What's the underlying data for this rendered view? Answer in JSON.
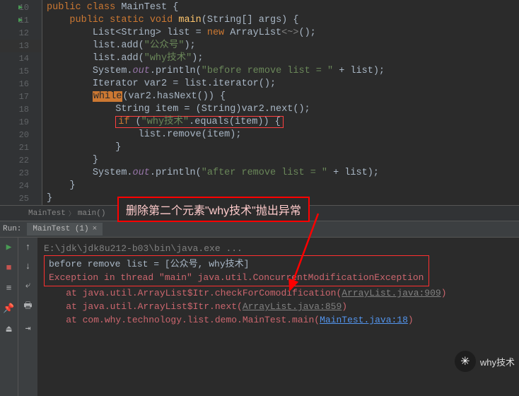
{
  "gutter": {
    "start": 10,
    "end": 25,
    "runMarkers": [
      10,
      11
    ]
  },
  "code": {
    "l10": {
      "kw1": "public class ",
      "cls": "MainTest",
      "end": " {"
    },
    "l11": {
      "kw1": "public static void ",
      "fn": "main",
      "args": "(String[] args) {"
    },
    "l12": {
      "t1": "List<String> list = ",
      "kw": "new ",
      "t2": "ArrayList",
      "gr": "<~>",
      "t3": "();"
    },
    "l13": {
      "t1": "list.add(",
      "s": "\"公众号\"",
      "t2": ");"
    },
    "l14": {
      "t1": "list.add(",
      "s": "\"why技术\"",
      "t2": ");"
    },
    "l15": {
      "t1": "System.",
      "f": "out",
      "t2": ".println(",
      "s": "\"before remove list = \"",
      "t3": " + list);"
    },
    "l16": {
      "t1": "Iterator var2 = list.iterator();"
    },
    "l17": {
      "kw": "while",
      "t1": "(var2.hasNext()) {"
    },
    "l18": {
      "t1": "String item = (String)var2.next();"
    },
    "l19": {
      "kw": "if ",
      "op": "(",
      "s": "\"why技术\"",
      "t1": ".equals(item)) {"
    },
    "l20": {
      "t1": "list.remove(item);"
    },
    "l21": {
      "t1": "}"
    },
    "l22": {
      "t1": "}"
    },
    "l23": {
      "t1": "System.",
      "f": "out",
      "t2": ".println(",
      "s": "\"after remove list = \"",
      "t3": " + list);"
    },
    "l24": {
      "t1": "}"
    },
    "l25": {
      "t1": "}"
    }
  },
  "annotation": "删除第二个元素\"why技术\"抛出异常",
  "breadcrumb": {
    "item1": "MainTest",
    "item2": "main()"
  },
  "run": {
    "label": "Run:",
    "tab": "MainTest (1)"
  },
  "console": {
    "cmd": "E:\\jdk\\jdk8u212-b03\\bin\\java.exe ...",
    "out1": "before remove list = [公众号, why技术]",
    "err1": "Exception in thread \"main\" java.util.ConcurrentModificationException",
    "err2a": "    at java.util.ArrayList$Itr.checkForComodification(",
    "err2b": "ArrayList.java:909",
    "err3a": "    at java.util.ArrayList$Itr.next(",
    "err3b": "ArrayList.java:859",
    "err4a": "    at com.why.technology.list.demo.MainTest.main(",
    "err4b": "MainTest.java:18",
    "paren": ")"
  },
  "watermark": "why技术"
}
